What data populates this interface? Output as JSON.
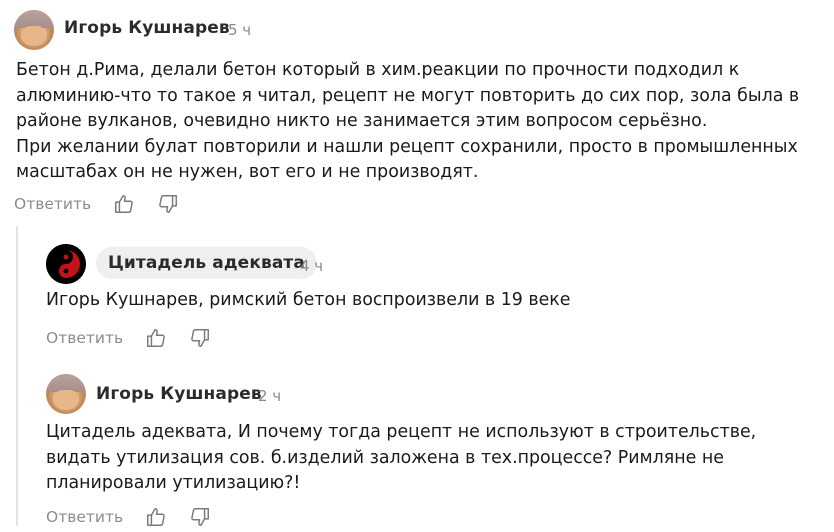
{
  "comments": [
    {
      "author": "Игорь Кушнарев",
      "time": "5 ч",
      "text": "Бетон д.Рима, делали бетон который в хим.реакции по прочности подходил к алюминию-что то такое я читал, рецепт не могут повторить до сих пор, зола была в районе вулканов, очевидно никто не занимается этим вопросом серьёзно.\nПри желании булат повторили и нашли рецепт сохранили, просто в промышленных масштабах он не нужен, вот его и не производят.",
      "reply_label": "Ответить",
      "like_icon": "thumbs-up-icon",
      "dislike_icon": "thumbs-down-icon"
    },
    {
      "author": "Цитадель адеквата",
      "time": "4 ч",
      "text": "Игорь Кушнарев, римский бетон воспроизвели в 19 веке",
      "reply_label": "Ответить",
      "like_icon": "thumbs-up-icon",
      "dislike_icon": "thumbs-down-icon"
    },
    {
      "author": "Игорь Кушнарев",
      "time": "2 ч",
      "text": "Цитадель адеквата, И почему тогда рецепт не используют в строительстве, видать утилизация сов. б.изделий заложена в тех.процессе? Римляне не планировали утилизацию?!",
      "reply_label": "Ответить",
      "like_icon": "thumbs-up-icon",
      "dislike_icon": "thumbs-down-icon"
    }
  ],
  "colors": {
    "text": "#1a1a1a",
    "muted": "#8a8a8a",
    "pill_bg": "#efefef",
    "thread_line": "#e3e3e3"
  }
}
